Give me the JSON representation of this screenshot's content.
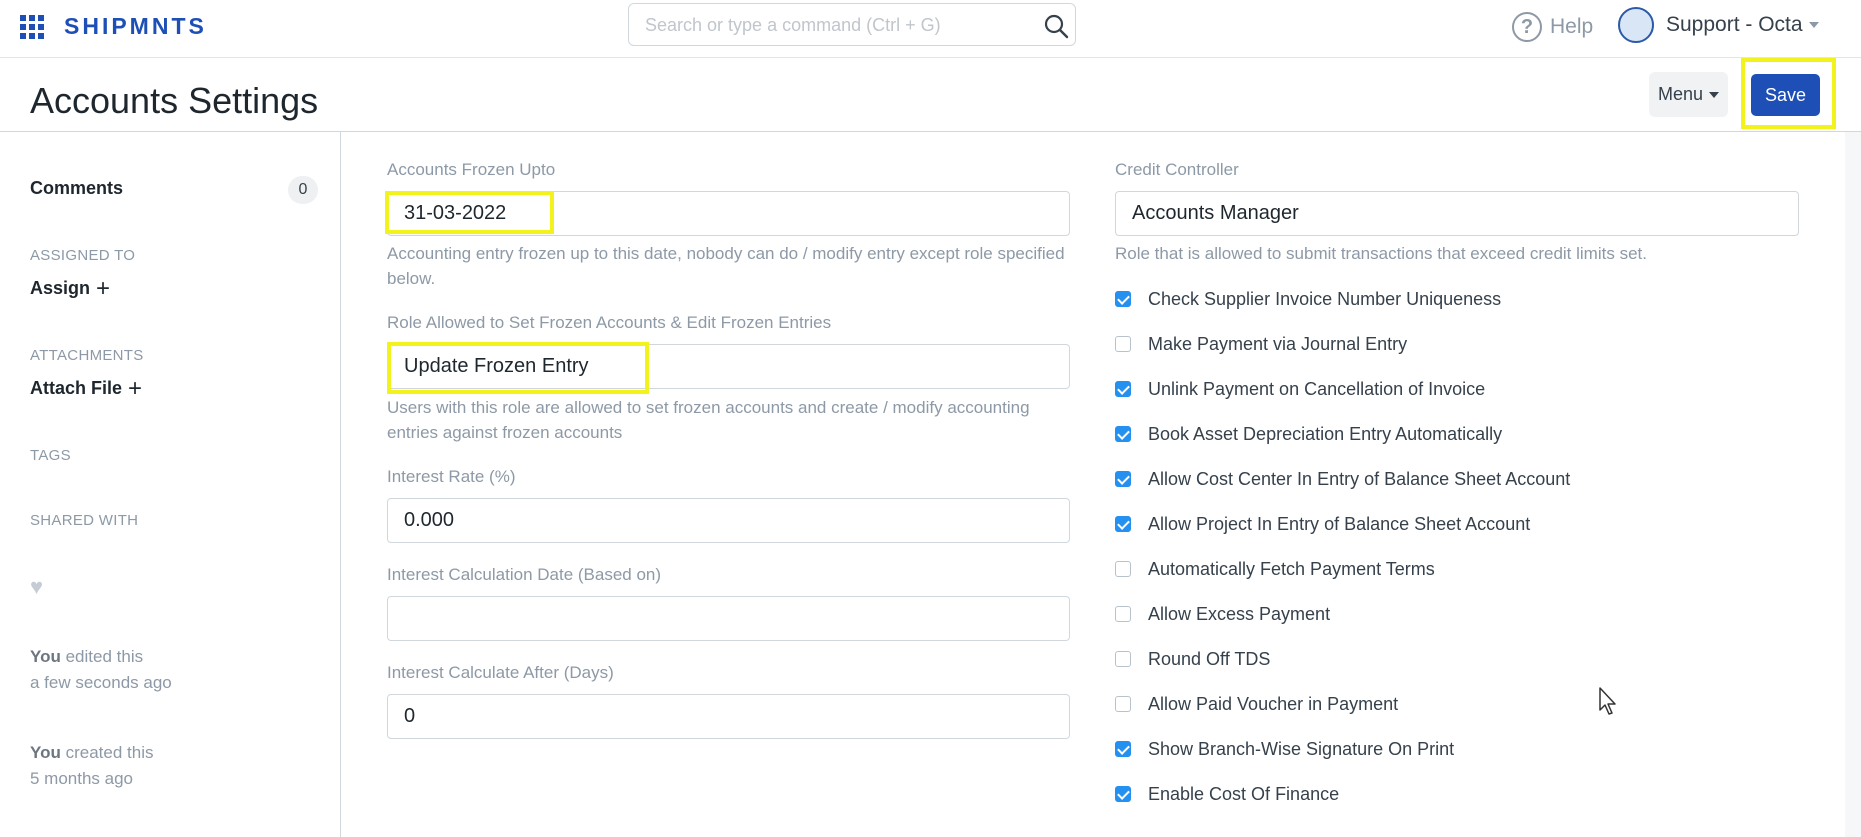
{
  "navbar": {
    "brand": "SHIPMNTS",
    "search_placeholder": "Search or type a command (Ctrl + G)",
    "help_label": "Help",
    "user_name": "Support - Octa"
  },
  "page": {
    "title": "Accounts Settings",
    "menu_label": "Menu",
    "save_label": "Save"
  },
  "sidebar": {
    "comments_label": "Comments",
    "comments_count": "0",
    "assigned_to": "ASSIGNED TO",
    "assign_label": "Assign",
    "attachments": "ATTACHMENTS",
    "attach_label": "Attach File",
    "tags": "TAGS",
    "shared_with": "SHARED WITH",
    "activity": [
      {
        "who": "You",
        "action": "edited this",
        "when": "a few seconds ago"
      },
      {
        "who": "You",
        "action": "created this",
        "when": "5 months ago"
      }
    ]
  },
  "form": {
    "frozen_upto": {
      "label": "Accounts Frozen Upto",
      "value": "31-03-2022",
      "desc": "Accounting entry frozen up to this date, nobody can do / modify entry except role specified below."
    },
    "frozen_role": {
      "label": "Role Allowed to Set Frozen Accounts & Edit Frozen Entries",
      "value": "Update Frozen Entry",
      "desc": "Users with this role are allowed to set frozen accounts and create / modify accounting entries against frozen accounts"
    },
    "interest_rate": {
      "label": "Interest Rate (%)",
      "value": "0.000"
    },
    "interest_date": {
      "label": "Interest Calculation Date (Based on)",
      "value": ""
    },
    "interest_after": {
      "label": "Interest Calculate After (Days)",
      "value": "0"
    },
    "credit_controller": {
      "label": "Credit Controller",
      "value": "Accounts Manager",
      "desc": "Role that is allowed to submit transactions that exceed credit limits set."
    },
    "checkboxes": [
      {
        "label": "Check Supplier Invoice Number Uniqueness",
        "checked": true
      },
      {
        "label": "Make Payment via Journal Entry",
        "checked": false
      },
      {
        "label": "Unlink Payment on Cancellation of Invoice",
        "checked": true
      },
      {
        "label": "Book Asset Depreciation Entry Automatically",
        "checked": true
      },
      {
        "label": "Allow Cost Center In Entry of Balance Sheet Account",
        "checked": true
      },
      {
        "label": "Allow Project In Entry of Balance Sheet Account",
        "checked": true
      },
      {
        "label": "Automatically Fetch Payment Terms",
        "checked": false
      },
      {
        "label": "Allow Excess Payment",
        "checked": false
      },
      {
        "label": "Round Off TDS",
        "checked": false
      },
      {
        "label": "Allow Paid Voucher in Payment",
        "checked": false
      },
      {
        "label": "Show Branch-Wise Signature On Print",
        "checked": true
      },
      {
        "label": "Enable Cost Of Finance",
        "checked": true
      }
    ]
  },
  "colors": {
    "brand": "#1d4fb7",
    "highlight": "#f2f21c",
    "checkbox_on": "#2490ef"
  }
}
